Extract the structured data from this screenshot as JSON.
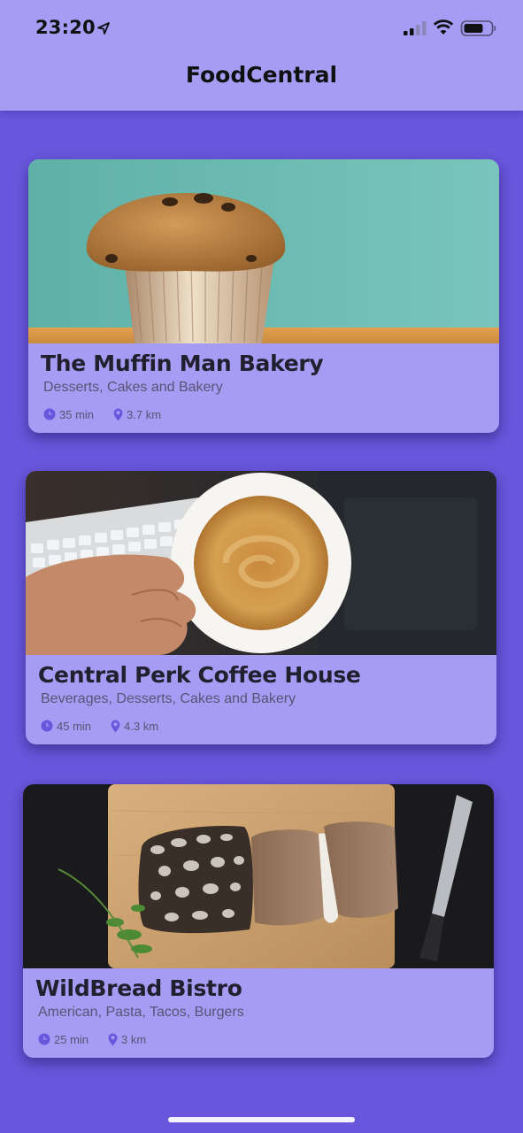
{
  "status_bar": {
    "time": "23:20",
    "icons": [
      "location-arrow-icon",
      "cellular-signal-icon",
      "wifi-icon",
      "battery-icon"
    ]
  },
  "nav": {
    "title": "FoodCentral"
  },
  "colors": {
    "background": "#6956dc",
    "bar": "#a69cf4",
    "card": "#a69cf4",
    "accent": "#6956dc"
  },
  "restaurants": [
    {
      "name": "The Muffin Man Bakery",
      "categories": "Desserts, Cakes and Bakery",
      "time": "35 min",
      "distance": "3.7 km",
      "image": "muffin-photo"
    },
    {
      "name": "Central Perk Coffee House",
      "categories": "Beverages, Desserts, Cakes and Bakery",
      "time": "45 min",
      "distance": "4.3 km",
      "image": "coffee-photo"
    },
    {
      "name": "WildBread Bistro",
      "categories": "American, Pasta, Tacos, Burgers",
      "time": "25 min",
      "distance": "3 km",
      "image": "bread-photo"
    }
  ]
}
